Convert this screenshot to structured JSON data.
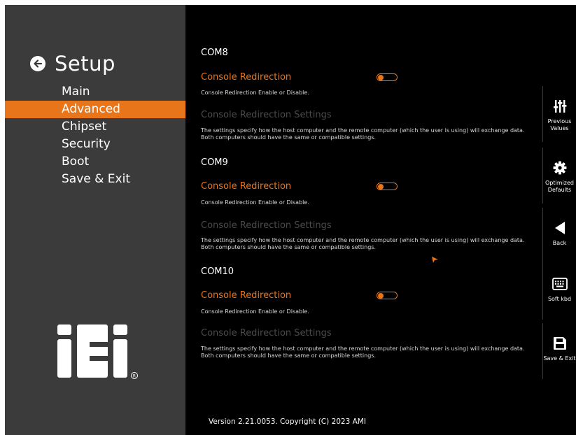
{
  "header": {
    "back_icon": "arrow-left-icon",
    "title": "Setup"
  },
  "nav": {
    "items": [
      {
        "label": "Main",
        "active": false
      },
      {
        "label": "Advanced",
        "active": true
      },
      {
        "label": "Chipset",
        "active": false
      },
      {
        "label": "Security",
        "active": false
      },
      {
        "label": "Boot",
        "active": false
      },
      {
        "label": "Save & Exit",
        "active": false
      }
    ]
  },
  "logo": {
    "text": "iEi"
  },
  "sections": [
    {
      "title": "COM8",
      "redirection_label": "Console Redirection",
      "redirection_enabled": false,
      "redirection_help": "Console Redirection Enable or Disable.",
      "settings_label": "Console Redirection Settings",
      "settings_help": "The settings specify how the host computer and the remote computer (which the user is using) will exchange data. Both computers should have the same or compatible settings."
    },
    {
      "title": "COM9",
      "redirection_label": "Console Redirection",
      "redirection_enabled": false,
      "redirection_help": "Console Redirection Enable or Disable.",
      "settings_label": "Console Redirection Settings",
      "settings_help": "The settings specify how the host computer and the remote computer (which the user is using) will exchange data. Both computers should have the same or compatible settings."
    },
    {
      "title": "COM10",
      "redirection_label": "Console Redirection",
      "redirection_enabled": false,
      "redirection_help": "Console Redirection Enable or Disable.",
      "settings_label": "Console Redirection Settings",
      "settings_help": "The settings specify how the host computer and the remote computer (which the user is using) will exchange data. Both computers should have the same or compatible settings."
    }
  ],
  "footer": {
    "version": "Version 2.21.0053. Copyright (C) 2023 AMI"
  },
  "right_panel": {
    "buttons": [
      {
        "icon": "sliders-icon",
        "label": "Previous Values"
      },
      {
        "icon": "gear-icon",
        "label": "Optimized Defaults"
      },
      {
        "icon": "back-triangle-icon",
        "label": "Back"
      },
      {
        "icon": "keyboard-icon",
        "label": "Soft kbd"
      },
      {
        "icon": "save-disk-icon",
        "label": "Save & Exit"
      }
    ]
  },
  "colors": {
    "accent": "#e8751a",
    "sidebar_bg": "#3b3b3b",
    "content_bg": "#000000",
    "disabled_text": "#4a4a4a"
  }
}
